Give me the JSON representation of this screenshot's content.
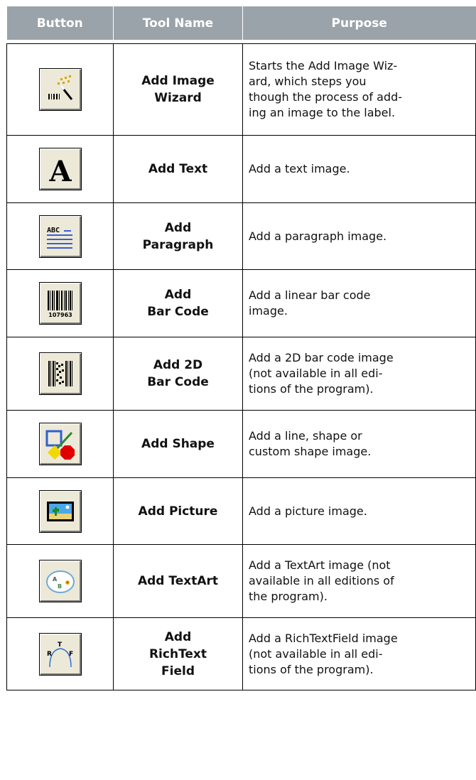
{
  "columns": {
    "button": "Button",
    "tool_name": "Tool Name",
    "purpose": "Purpose"
  },
  "rows": [
    {
      "icon": "add-image-wizard-icon",
      "tool_line1": "Add Image",
      "tool_line2": "Wizard",
      "tool_line3": "",
      "purpose_lines": [
        "Starts the Add Image Wiz-",
        "ard, which steps you",
        "though the process of add-",
        "ing an image to the label."
      ]
    },
    {
      "icon": "add-text-icon",
      "tool_line1": "Add Text",
      "tool_line2": "",
      "tool_line3": "",
      "purpose_lines": [
        "Add a text image."
      ]
    },
    {
      "icon": "add-paragraph-icon",
      "tool_line1": "Add",
      "tool_line2": "Paragraph",
      "tool_line3": "",
      "purpose_lines": [
        "Add a paragraph image."
      ]
    },
    {
      "icon": "add-bar-code-icon",
      "tool_line1": "Add",
      "tool_line2": "Bar Code",
      "tool_line3": "",
      "icon_text": "107963",
      "purpose_lines": [
        "Add a linear bar code",
        "image."
      ]
    },
    {
      "icon": "add-2d-bar-code-icon",
      "tool_line1": "Add 2D",
      "tool_line2": "Bar Code",
      "tool_line3": "",
      "purpose_lines": [
        "Add a 2D bar code image",
        "(not available in all edi-",
        "tions of the program)."
      ]
    },
    {
      "icon": "add-shape-icon",
      "tool_line1": "Add Shape",
      "tool_line2": "",
      "tool_line3": "",
      "purpose_lines": [
        "Add a line, shape or",
        "custom shape image."
      ]
    },
    {
      "icon": "add-picture-icon",
      "tool_line1": "Add Picture",
      "tool_line2": "",
      "tool_line3": "",
      "purpose_lines": [
        "Add a picture image."
      ]
    },
    {
      "icon": "add-textart-icon",
      "tool_line1": "Add TextArt",
      "tool_line2": "",
      "tool_line3": "",
      "purpose_lines": [
        "Add a TextArt image (not",
        "available in all editions of",
        "the program)."
      ]
    },
    {
      "icon": "add-richtext-field-icon",
      "tool_line1": "Add",
      "tool_line2": "RichText",
      "tool_line3": "Field",
      "purpose_lines": [
        "Add a RichTextField image",
        "(not available in all edi-",
        "tions of the program)."
      ]
    }
  ]
}
